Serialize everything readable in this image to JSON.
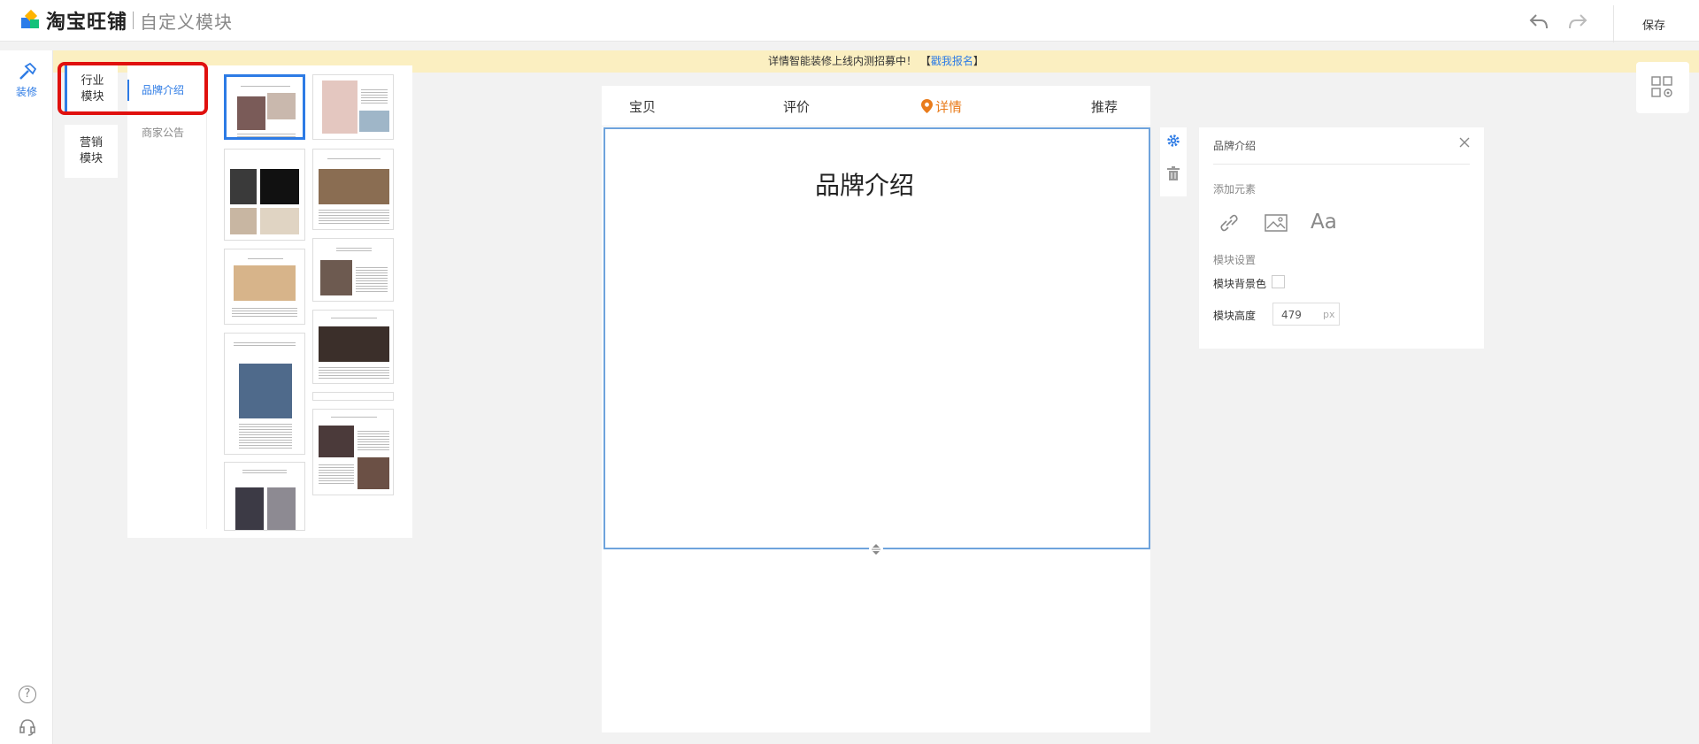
{
  "header": {
    "brand": "淘宝旺铺",
    "subtitle": "自定义模块",
    "save_label": "保存"
  },
  "leftnav": {
    "decorate_label": "装修"
  },
  "notice": {
    "text": "详情智能装修上线内测招募中！",
    "link_open": "【",
    "link_text": "戳我报名",
    "link_close": "】"
  },
  "module_tabs": [
    {
      "label_line1": "行业",
      "label_line2": "模块"
    },
    {
      "label_line1": "营销",
      "label_line2": "模块"
    }
  ],
  "sub_categories": [
    {
      "label": "品牌介绍",
      "active": true
    },
    {
      "label": "商家公告",
      "active": false
    }
  ],
  "canvas": {
    "nav": [
      {
        "label": "宝贝"
      },
      {
        "label": "评价"
      },
      {
        "label": "详情",
        "active": true
      },
      {
        "label": "推荐"
      }
    ],
    "module_title": "品牌介绍"
  },
  "props": {
    "title": "品牌介绍",
    "add_elements_label": "添加元素",
    "text_element_label": "Aa",
    "module_settings_label": "模块设置",
    "bg_color_label": "模块背景色",
    "height_label": "模块高度",
    "height_value": "479",
    "height_unit": "px"
  },
  "colors": {
    "accent": "#2d7be5",
    "active_tab": "#e97c1c",
    "highlight": "#e0100e",
    "notice_bg": "#fbefc1"
  }
}
